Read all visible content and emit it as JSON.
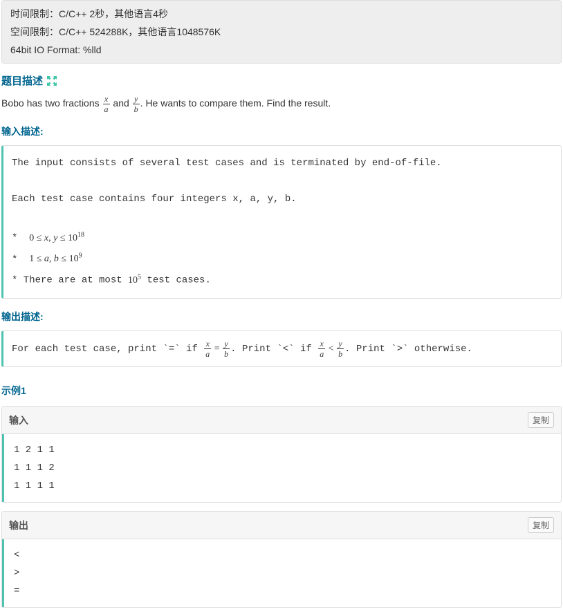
{
  "limits": {
    "time": "时间限制：C/C++ 2秒，其他语言4秒",
    "space": "空间限制：C/C++ 524288K，其他语言1048576K",
    "io64": "64bit IO Format: %lld"
  },
  "titles": {
    "problem_desc": "题目描述",
    "input_desc": "输入描述:",
    "output_desc": "输出描述:",
    "example": "示例1",
    "input_label": "输入",
    "output_label": "输出"
  },
  "problem": {
    "part1": "Bobo has two fractions ",
    "and": " and ",
    "part2": ". He wants to compare them. Find the result.",
    "x": "x",
    "a": "a",
    "y": "y",
    "b": "b"
  },
  "input_desc": {
    "line1": "The input consists of several test cases and is terminated by end-of-file.",
    "line2": "Each test case contains four integers x, a, y, b.",
    "c1a": "0 ≤ ",
    "c1b": "x, y",
    "c1c": " ≤ 10",
    "c1e": "18",
    "c2a": "1 ≤ ",
    "c2b": "a, b",
    "c2c": " ≤ 10",
    "c2e": "9",
    "c3a": "* There are at most ",
    "c3b": "10",
    "c3e": "5",
    "c3c": " test cases."
  },
  "output_desc": {
    "p1": "For each test case, print `=` if ",
    "eq": " = ",
    "p2": ". Print `<` if ",
    "lt": " < ",
    "p3": ". Print `>` otherwise."
  },
  "example_io": {
    "input": "1 2 1 1\n1 1 1 2\n1 1 1 1",
    "output": "<\n>\n="
  },
  "buttons": {
    "copy": "复制"
  }
}
